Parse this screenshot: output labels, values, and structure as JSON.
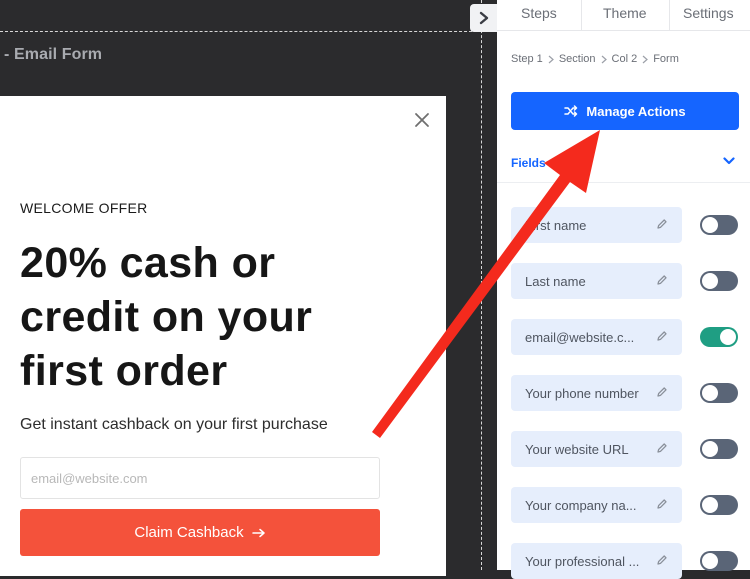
{
  "canvas": {
    "title": "- Email Form"
  },
  "popup": {
    "eyebrow": "WELCOME OFFER",
    "headline_lines": [
      "20% cash or",
      "credit on your",
      "first order"
    ],
    "subtitle": "Get instant cashback on your first purchase",
    "email_placeholder": "email@website.com",
    "cta_label": "Claim Cashback",
    "cta_icon": "arrow-right-icon",
    "cta_color": "#f4523b"
  },
  "panel": {
    "tabs": [
      "Steps",
      "Theme",
      "Settings"
    ],
    "breadcrumb": [
      "Step 1",
      "Section",
      "Col 2",
      "Form"
    ],
    "manage_actions_label": "Manage Actions",
    "manage_actions_icon": "shuffle-icon",
    "accent_color": "#1565ff",
    "fields_label": "Fields",
    "fields": [
      {
        "label": "First name",
        "enabled": false
      },
      {
        "label": "Last name",
        "enabled": false
      },
      {
        "label": "email@website.c...",
        "enabled": true
      },
      {
        "label": "Your phone number",
        "enabled": false
      },
      {
        "label": "Your website URL",
        "enabled": false
      },
      {
        "label": "Your company na...",
        "enabled": false
      },
      {
        "label": "Your professional ...",
        "enabled": false
      }
    ]
  },
  "annotation": {
    "type": "red-arrow",
    "color": "#f42a1d",
    "points_to": "manage-actions-button"
  }
}
